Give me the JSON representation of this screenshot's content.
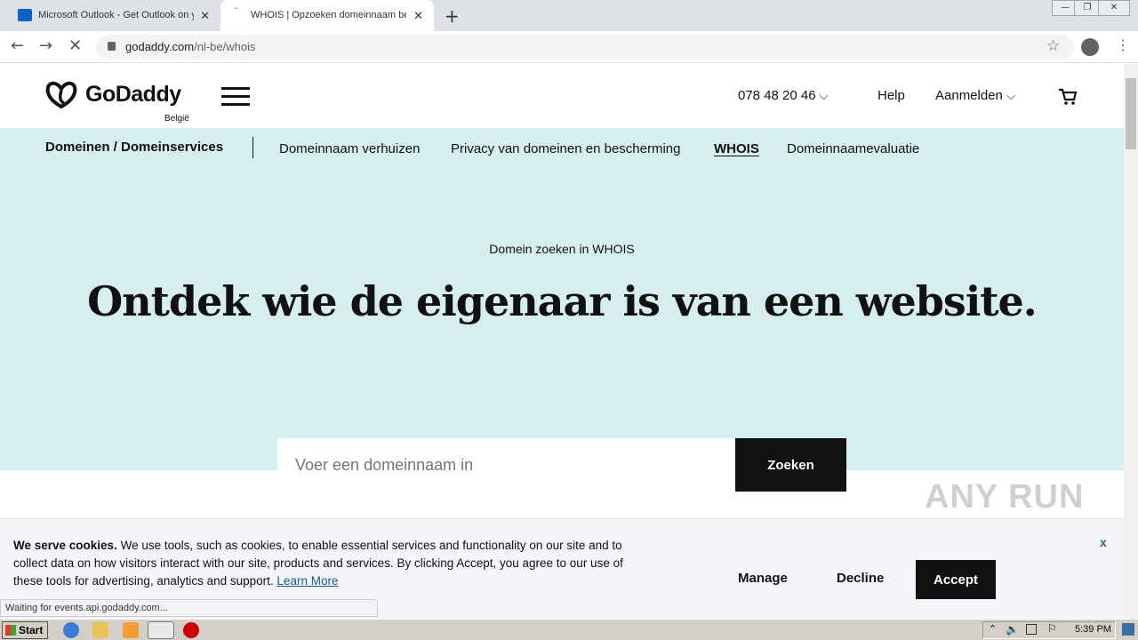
{
  "browser": {
    "tabs": [
      {
        "title": "Microsoft Outlook - Get Outlook on y",
        "active": false
      },
      {
        "title": "WHOIS | Opzoeken domeinnaam bes",
        "active": true
      }
    ],
    "url_host": "godaddy.com",
    "url_path": "/nl-be/whois",
    "status_text": "Waiting for events.api.godaddy.com..."
  },
  "header": {
    "logo": "GoDaddy",
    "region": "België",
    "phone": "078 48 20 46",
    "help": "Help",
    "signin": "Aanmelden"
  },
  "subnav": {
    "title": "Domeinen / Domeinservices",
    "items": [
      {
        "label": "Domeinnaam verhuizen",
        "active": false
      },
      {
        "label": "Privacy van domeinen en bescherming",
        "active": false
      },
      {
        "label": "WHOIS",
        "active": true
      },
      {
        "label": "Domeinnaamevaluatie",
        "active": false
      }
    ]
  },
  "hero": {
    "eyebrow": "Domein zoeken in WHOIS",
    "headline": "Ontdek wie de eigenaar is van een website.",
    "search_placeholder": "Voer een domeinnaam in",
    "search_button": "Zoeken"
  },
  "cookie": {
    "lead": "We serve cookies.",
    "body": " We use tools, such as cookies, to enable essential services and functionality on our site and to collect data on how visitors interact with our site, products and services. By clicking Accept, you agree to our use of these tools for advertising, analytics and support. ",
    "learn_more": "Learn More",
    "manage": "Manage",
    "decline": "Decline",
    "accept": "Accept",
    "close": "x"
  },
  "watermark": "ANY RUN",
  "taskbar": {
    "start": "Start",
    "clock": "5:39 PM"
  },
  "colors": {
    "hero_bg": "#d6eeee",
    "button_dark": "#111111"
  }
}
